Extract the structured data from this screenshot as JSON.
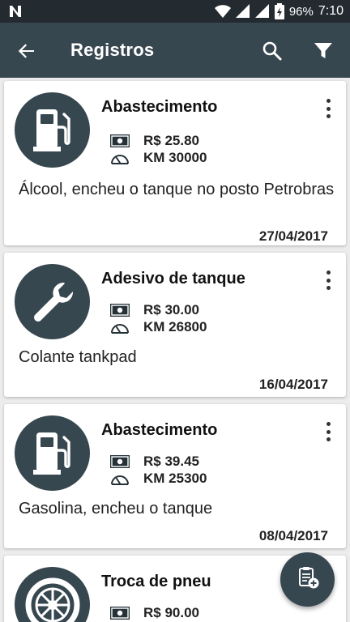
{
  "status_bar": {
    "battery": "96%",
    "time": "7:10"
  },
  "app_bar": {
    "title": "Registros"
  },
  "records": [
    {
      "title": "Abastecimento",
      "icon": "fuel-pump-icon",
      "price": "R$  25.80",
      "km": "KM 30000",
      "note": "Álcool, encheu o tanque no posto Petrobras",
      "date": "27/04/2017"
    },
    {
      "title": "Adesivo de tanque",
      "icon": "wrench-icon",
      "price": "R$  30.00",
      "km": "KM 26800",
      "note": "Colante tankpad",
      "date": "16/04/2017"
    },
    {
      "title": "Abastecimento",
      "icon": "fuel-pump-icon",
      "price": "R$  39.45",
      "km": "KM 25300",
      "note": "Gasolina, encheu o tanque",
      "date": "08/04/2017"
    },
    {
      "title": "Troca de pneu",
      "icon": "tire-icon",
      "price": "R$  90.00",
      "km": "",
      "note": "",
      "date": ""
    }
  ],
  "colors": {
    "primary": "#37474f",
    "status_bar": "#232b30",
    "background": "#ececec"
  }
}
